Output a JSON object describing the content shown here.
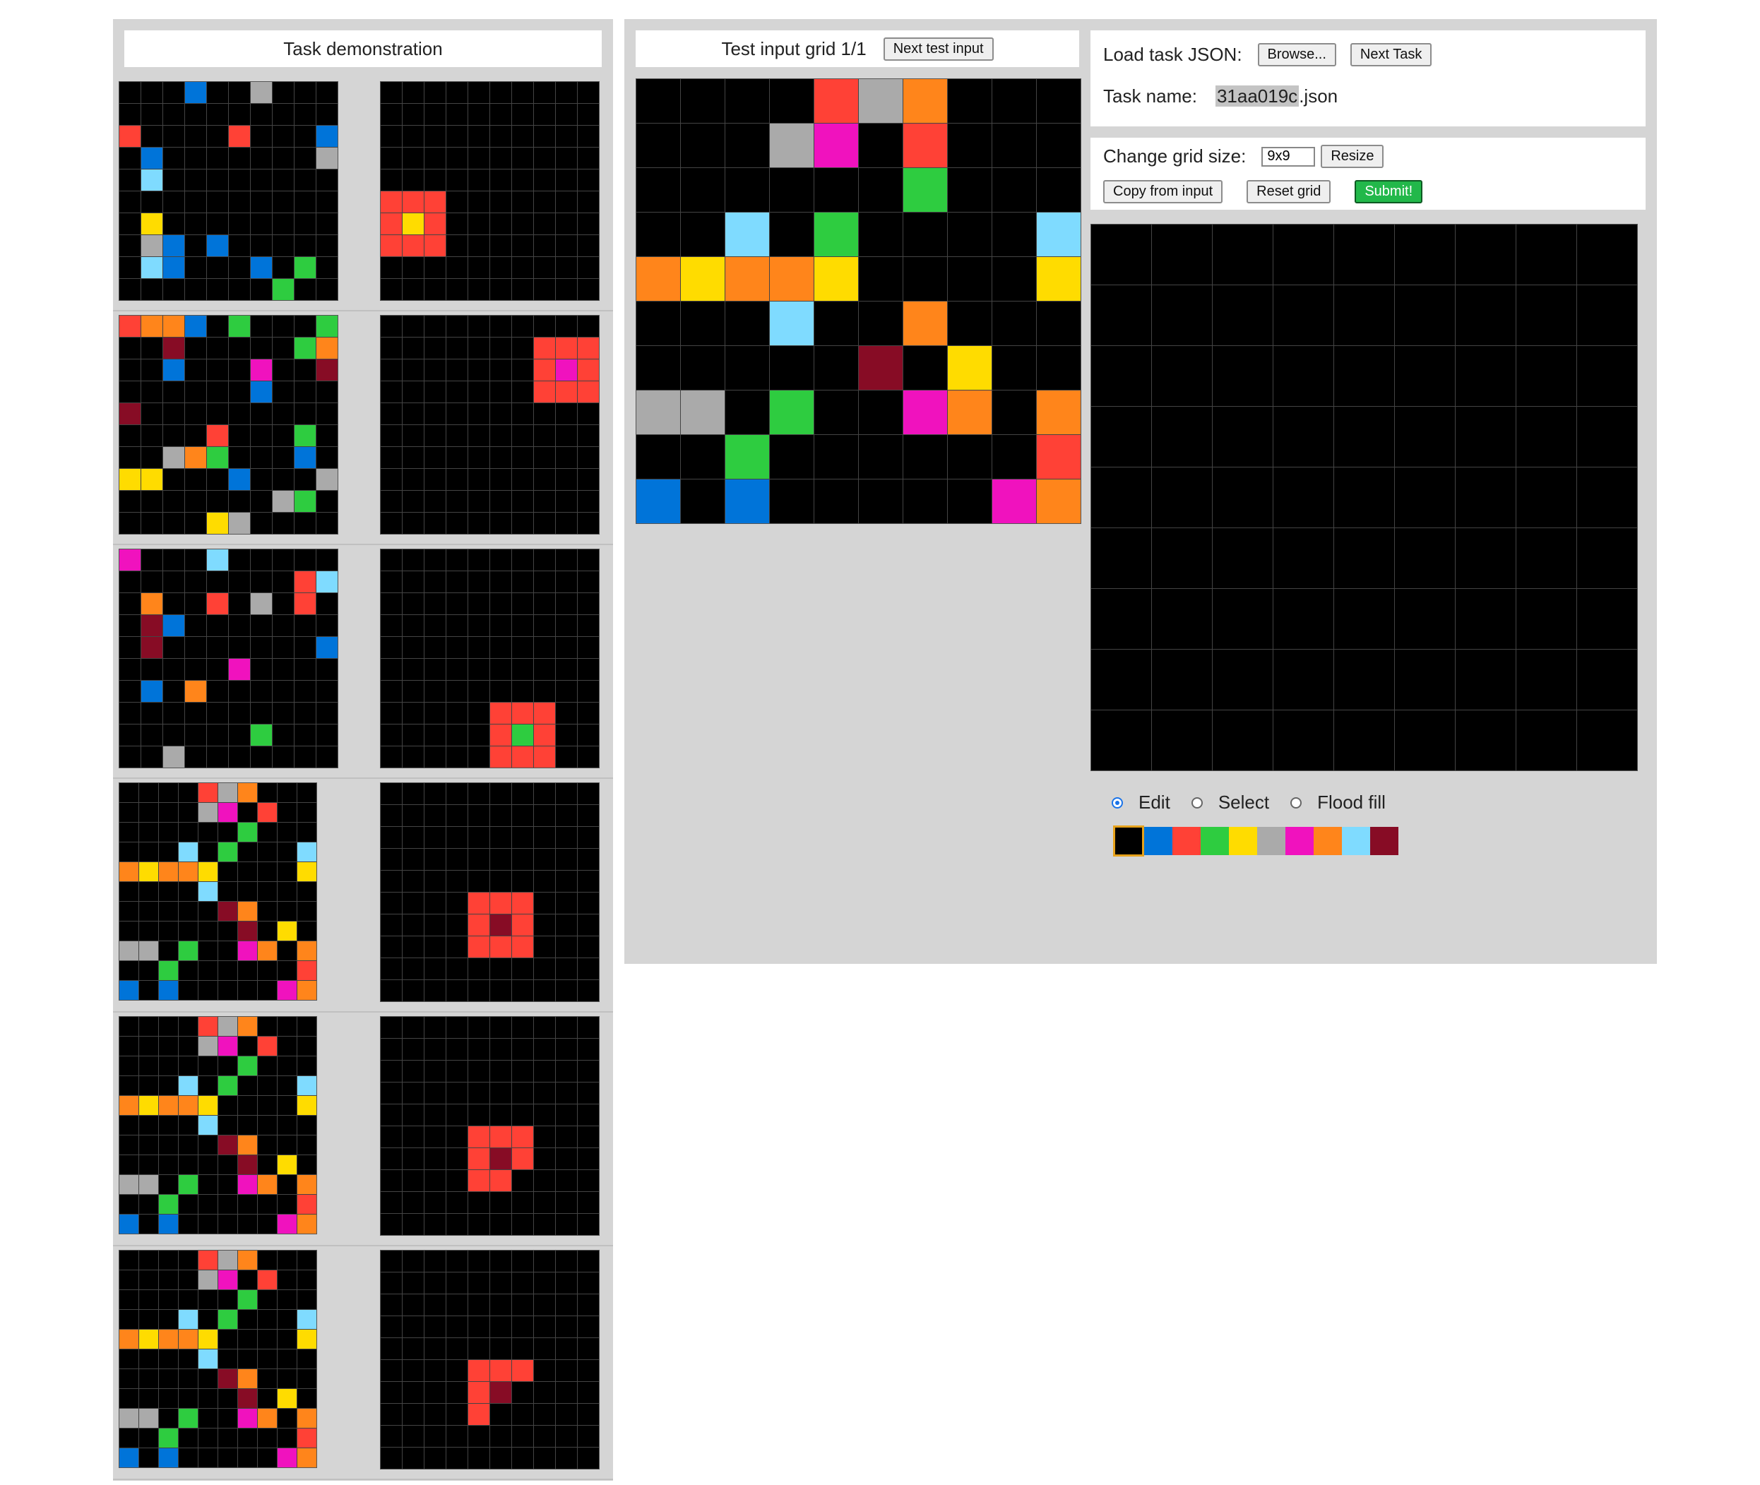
{
  "colors": [
    "#000000",
    "#0074D9",
    "#FF4136",
    "#2ECC40",
    "#FFDC00",
    "#AAAAAA",
    "#F012BE",
    "#FF851B",
    "#7FDBFF",
    "#870C25"
  ],
  "demo": {
    "title": "Task demonstration",
    "pairs": [
      {
        "input": [
          "0001005000",
          "0000000000",
          "2000020001",
          "0100000005",
          "0800000000",
          "0000000000",
          "0400000000",
          "0510100000",
          "0810001030",
          "0000000300"
        ],
        "output": [
          "0000000000",
          "0000000000",
          "0000000000",
          "0000000000",
          "0000000000",
          "2220000000",
          "2420000000",
          "2220000000",
          "0000000000",
          "0000000000"
        ]
      },
      {
        "input": [
          "2771030003",
          "0090000037",
          "0010006009",
          "0000001000",
          "9000000000",
          "0000200030",
          "0057300010",
          "4400010005",
          "0000000530",
          "0000450000"
        ],
        "output": [
          "0000000000",
          "0000000222",
          "0000000262",
          "0000000222",
          "0000000000",
          "0000000000",
          "0000000000",
          "0000000000",
          "0000000000",
          "0000000000"
        ]
      },
      {
        "input": [
          "6000800000",
          "0000000028",
          "0700205020",
          "0910000000",
          "0900000001",
          "0000060000",
          "0107000000",
          "0000000000",
          "0000003000",
          "0050000000"
        ],
        "output": [
          "0000000000",
          "0000000000",
          "0000000000",
          "0000000000",
          "0000000000",
          "0000000000",
          "0000000000",
          "0000022200",
          "0000023200",
          "0000022200"
        ]
      },
      {
        "input": [
          "0000257000",
          "0000560200",
          "0000003000",
          "0008030008",
          "7477400004",
          "0000800000",
          "0000097000",
          "0000009040",
          "5503006707",
          "0030000002",
          "1010000067"
        ],
        "output": [
          "0000000000",
          "0000000000",
          "0000000000",
          "0000000000",
          "0000000000",
          "0000222000",
          "0000292000",
          "0000222000",
          "0000000000",
          "0000000000"
        ]
      },
      {
        "input": [
          "0000257000",
          "0000560200",
          "0000003000",
          "0008030008",
          "7477400004",
          "0000800000",
          "0000097000",
          "0000009040",
          "5503006707",
          "0030000002",
          "1010000067"
        ],
        "output": [
          "0000000000",
          "0000000000",
          "0000000000",
          "0000000000",
          "0000000000",
          "0000222000",
          "0000292000",
          "0000220000",
          "0000000000",
          "0000000000"
        ]
      },
      {
        "input": [
          "0000257000",
          "0000560200",
          "0000003000",
          "0008030008",
          "7477400004",
          "0000800000",
          "0000097000",
          "0000009040",
          "5503006707",
          "0030000002",
          "1010000067"
        ],
        "output": [
          "0000000000",
          "0000000000",
          "0000000000",
          "0000000000",
          "0000000000",
          "0000222000",
          "0000290000",
          "0000200000",
          "0000000000",
          "0000000000"
        ]
      }
    ]
  },
  "test": {
    "title": "Test input grid 1/1",
    "next_button": "Next test input",
    "grid": [
      "0000257000",
      "0005602000",
      "0000003000",
      "0080300008",
      "7477400004",
      "0008007000",
      "0000090400",
      "5503006707",
      "0030000002",
      "1010000067"
    ]
  },
  "controls": {
    "load_label": "Load task JSON:",
    "browse_button": "Browse...",
    "next_task_button": "Next Task",
    "task_name_label": "Task name:",
    "task_name_highlight": "31aa019c",
    "task_name_suffix": ".json",
    "change_size_label": "Change grid size:",
    "size_value": "9x9",
    "resize_button": "Resize",
    "copy_button": "Copy from input",
    "reset_button": "Reset grid",
    "submit_button": "Submit!",
    "modes": [
      {
        "label": "Edit",
        "selected": true
      },
      {
        "label": "Select",
        "selected": false
      },
      {
        "label": "Flood fill",
        "selected": false
      }
    ],
    "selected_color_index": 0
  },
  "output_grid": {
    "rows": 9,
    "cols": 9
  }
}
